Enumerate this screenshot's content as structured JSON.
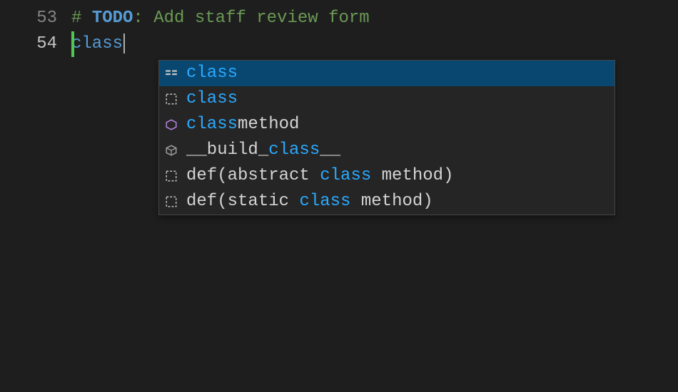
{
  "lines": [
    {
      "num": "53",
      "active": false
    },
    {
      "num": "54",
      "active": true
    }
  ],
  "code": {
    "comment_hash": "# ",
    "comment_todo": "TODO",
    "comment_rest": ": Add staff review form",
    "typed_keyword": "class"
  },
  "autocomplete": {
    "items": [
      {
        "icon": "keyword-icon",
        "parts": [
          {
            "t": "class",
            "m": true
          }
        ],
        "selected": true
      },
      {
        "icon": "snippet-icon",
        "parts": [
          {
            "t": "class",
            "m": true
          }
        ],
        "selected": false
      },
      {
        "icon": "method-icon",
        "parts": [
          {
            "t": "class",
            "m": true
          },
          {
            "t": "method",
            "m": false
          }
        ],
        "selected": false
      },
      {
        "icon": "module-icon",
        "parts": [
          {
            "t": "__build_",
            "m": false
          },
          {
            "t": "class",
            "m": true
          },
          {
            "t": "__",
            "m": false
          }
        ],
        "selected": false
      },
      {
        "icon": "snippet-icon",
        "parts": [
          {
            "t": "def(abstract ",
            "m": false
          },
          {
            "t": "class",
            "m": true
          },
          {
            "t": " method)",
            "m": false
          }
        ],
        "selected": false
      },
      {
        "icon": "snippet-icon",
        "parts": [
          {
            "t": "def(static ",
            "m": false
          },
          {
            "t": "class",
            "m": true
          },
          {
            "t": " method)",
            "m": false
          }
        ],
        "selected": false
      }
    ]
  }
}
